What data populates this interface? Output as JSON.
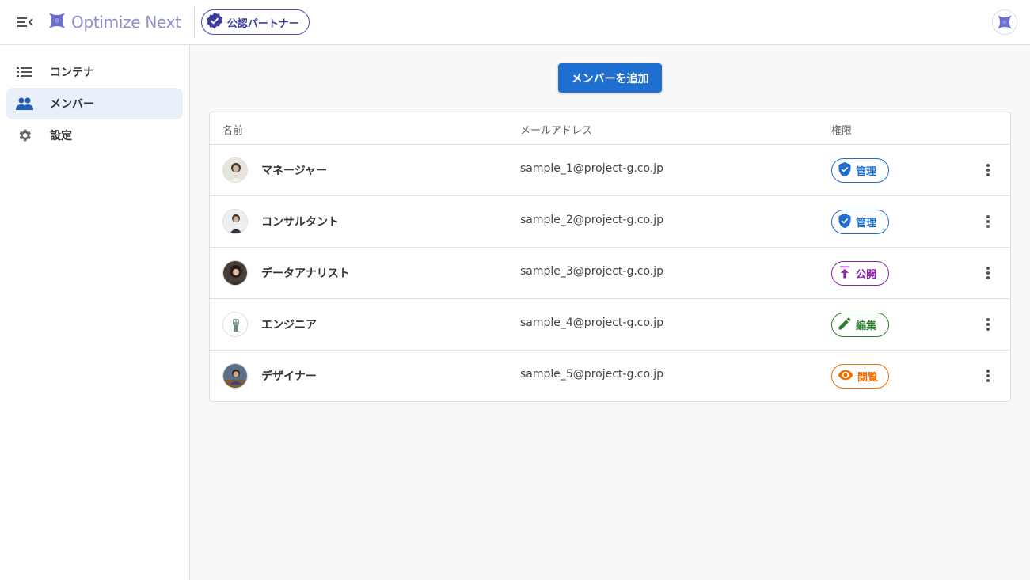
{
  "app": {
    "logo_text": "Optimize Next",
    "partner_badge": "公認パートナー"
  },
  "sidebar": {
    "items": [
      {
        "label": "コンテナ",
        "icon": "list-icon",
        "active": false
      },
      {
        "label": "メンバー",
        "icon": "people-icon",
        "active": true
      },
      {
        "label": "設定",
        "icon": "gear-icon",
        "active": false
      }
    ]
  },
  "main": {
    "add_button": "メンバーを追加",
    "table": {
      "headers": {
        "name": "名前",
        "email": "メールアドレス",
        "role": "権限"
      },
      "rows": [
        {
          "name": "マネージャー",
          "email": "sample_1@project-g.co.jp",
          "role": "管理",
          "role_icon": "shield-check-icon",
          "role_color": "#1f6fd0"
        },
        {
          "name": "コンサルタント",
          "email": "sample_2@project-g.co.jp",
          "role": "管理",
          "role_icon": "shield-check-icon",
          "role_color": "#1f6fd0"
        },
        {
          "name": "データアナリスト",
          "email": "sample_3@project-g.co.jp",
          "role": "公開",
          "role_icon": "publish-icon",
          "role_color": "#8e24aa"
        },
        {
          "name": "エンジニア",
          "email": "sample_4@project-g.co.jp",
          "role": "編集",
          "role_icon": "pencil-icon",
          "role_color": "#2e7d32"
        },
        {
          "name": "デザイナー",
          "email": "sample_5@project-g.co.jp",
          "role": "閲覧",
          "role_icon": "eye-icon",
          "role_color": "#ef6c00"
        }
      ]
    }
  },
  "colors": {
    "primary": "#1f6fd0",
    "brand": "#6b6fcf",
    "active_nav_bg": "#eaf0fb"
  }
}
